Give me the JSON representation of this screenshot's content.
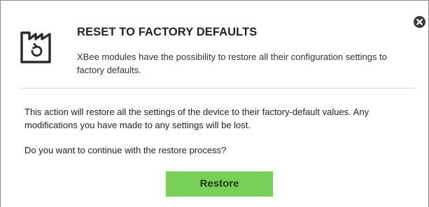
{
  "dialog": {
    "title": "RESET TO FACTORY DEFAULTS",
    "description": "XBee modules have the possibility to restore all their configuration settings to factory defaults.",
    "header_icon": "factory-reset-icon",
    "close_icon": "close-icon"
  },
  "body": {
    "message": "This action will restore all the settings of the device to their factory-default values. Any modifications you have made to any settings will be lost.",
    "question": "Do you want to continue with the restore process?"
  },
  "actions": {
    "restore_label": "Restore"
  },
  "colors": {
    "restore_button": "#78d058",
    "close_button": "#3a3a3a"
  }
}
